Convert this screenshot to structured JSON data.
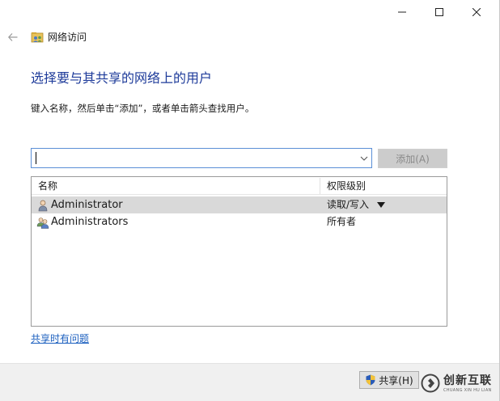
{
  "window": {
    "title": "网络访问",
    "caption_icons": [
      "minimize-icon",
      "maximize-icon",
      "close-icon"
    ]
  },
  "nav": {
    "back_icon": "arrow-left-icon"
  },
  "main": {
    "heading": "选择要与其共享的网络上的用户",
    "instruction": "键入名称，然后单击“添加”，或者单击箭头查找用户。"
  },
  "combo": {
    "value": "",
    "placeholder": ""
  },
  "add_button": {
    "label": "添加(A)",
    "enabled": false
  },
  "list": {
    "columns": [
      "名称",
      "权限级别"
    ],
    "rows": [
      {
        "name": "Administrator",
        "permission": "读取/写入",
        "icon": "user-icon",
        "selected": true,
        "has_dropdown": true
      },
      {
        "name": "Administrators",
        "permission": "所有者",
        "icon": "users-group-icon",
        "selected": false,
        "has_dropdown": false
      }
    ]
  },
  "help_link": {
    "label": "共享时有问题"
  },
  "footer": {
    "share_button": "共享(H)"
  },
  "watermark": {
    "brand": "创新互联",
    "sub": "CHUANG XIN HU LIAN"
  },
  "colors": {
    "heading": "#1e3b9a",
    "link": "#1b5fbf",
    "selection": "#d9d9d9",
    "combo_border": "#5b8fd6",
    "footer_bg": "#f0f0f0"
  }
}
